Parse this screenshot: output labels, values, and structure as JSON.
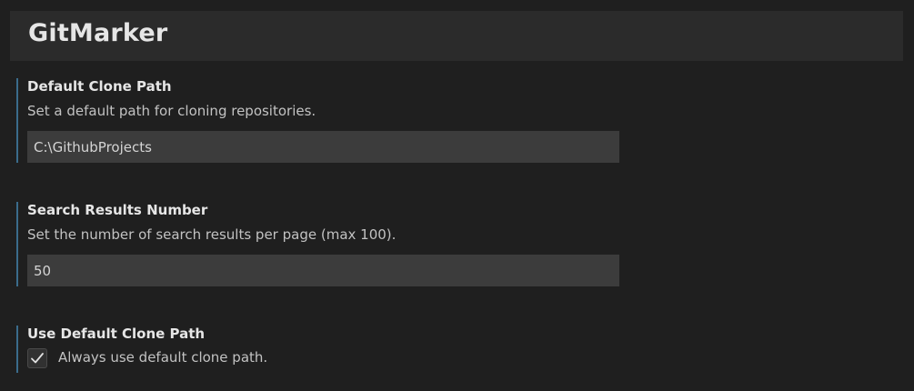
{
  "header": {
    "title": "GitMarker"
  },
  "settings": {
    "default_clone_path": {
      "title": "Default Clone Path",
      "description": "Set a default path for cloning repositories.",
      "value": "C:\\GithubProjects"
    },
    "search_results_number": {
      "title": "Search Results Number",
      "description": "Set the number of search results per page (max 100).",
      "value": "50"
    },
    "use_default_clone_path": {
      "title": "Use Default Clone Path",
      "checkbox_label": "Always use default clone path.",
      "checked": true
    }
  },
  "colors": {
    "background": "#1f1f1f",
    "header_background": "#2b2b2b",
    "input_background": "#3c3c3c",
    "accent_bar": "#3a6c8c",
    "text": "#cccccc"
  },
  "icons": {
    "checkbox_mark": "check-icon"
  }
}
